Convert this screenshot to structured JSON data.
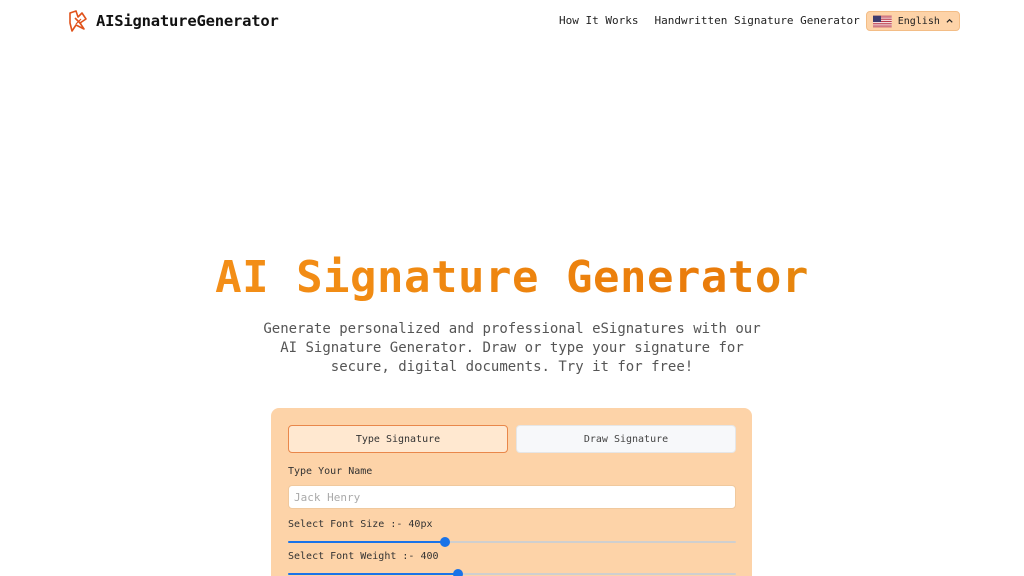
{
  "header": {
    "brand_name": "AISignatureGenerator",
    "brand_icon": "signature-pen-icon",
    "nav": [
      {
        "label": "How It Works"
      },
      {
        "label": "Handwritten Signature Generator"
      }
    ],
    "language": {
      "label": "English",
      "flag_icon": "us-flag-icon",
      "chevron_icon": "chevron-up-icon"
    }
  },
  "hero": {
    "title": "AI Signature Generator",
    "subtitle": "Generate personalized and professional eSignatures with our AI Signature Generator. Draw or type your signature for secure, digital documents. Try it for free!"
  },
  "card": {
    "tabs": [
      {
        "label": "Type Signature",
        "active": true
      },
      {
        "label": "Draw Signature",
        "active": false
      }
    ],
    "name_label": "Type Your Name",
    "name_placeholder": "Jack Henry",
    "font_size_label": "Select Font Size :- 40px",
    "font_size_level": 0.35,
    "font_weight_label": "Select Font Weight :- 400",
    "font_weight_level": 0.38
  },
  "colors": {
    "accent": "#f7931e",
    "card_bg": "#fdd3a8",
    "slider": "#1a73e8"
  }
}
